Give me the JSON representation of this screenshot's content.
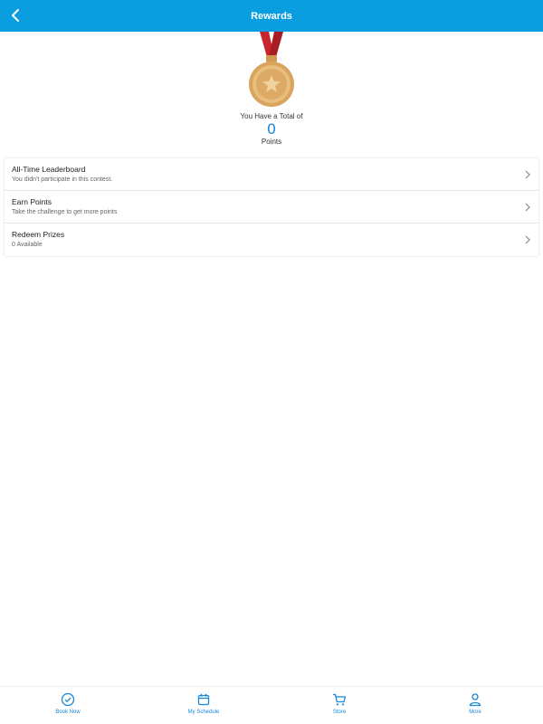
{
  "header": {
    "title": "Rewards"
  },
  "summary": {
    "total_label": "You Have a Total of",
    "points": "0",
    "points_unit": "Points"
  },
  "menu": [
    {
      "title": "All-Time Leaderboard",
      "subtitle": "You didn't participate in this contest."
    },
    {
      "title": "Earn Points",
      "subtitle": "Take the challenge to get more points"
    },
    {
      "title": "Redeem Prizes",
      "subtitle": "0 Available"
    }
  ],
  "tabs": [
    {
      "label": "Book Now",
      "icon": "check-circle-icon"
    },
    {
      "label": "My Schedule",
      "icon": "calendar-icon"
    },
    {
      "label": "Store",
      "icon": "cart-icon"
    },
    {
      "label": "More",
      "icon": "person-icon"
    }
  ],
  "colors": {
    "primary": "#0a9ee0",
    "accent": "#1a86d6",
    "medal_gold": "#d9a45c",
    "ribbon": "#c8262d"
  }
}
